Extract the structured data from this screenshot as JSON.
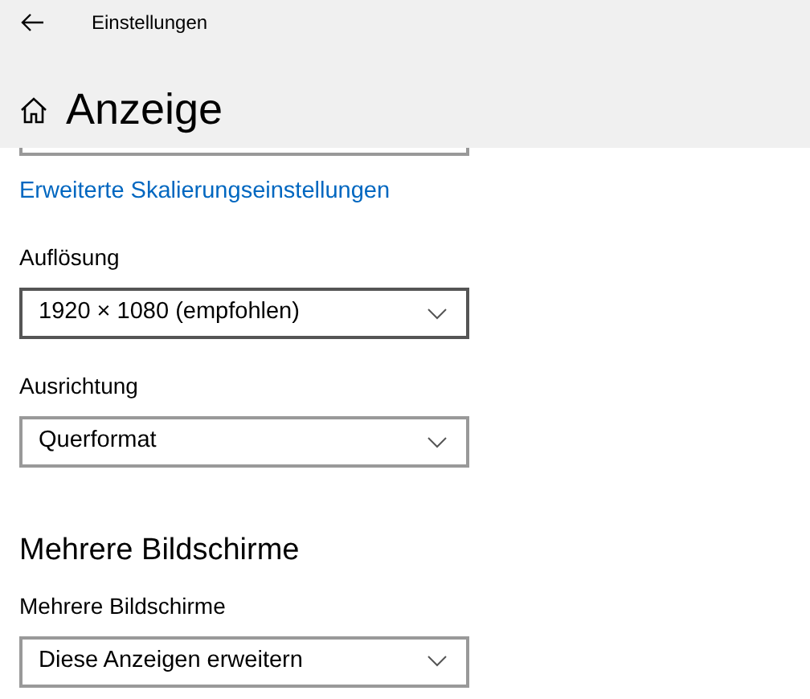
{
  "window": {
    "title": "Einstellungen"
  },
  "page": {
    "title": "Anzeige"
  },
  "scrolled_control": {
    "kind": "dropdown"
  },
  "link": "Erweiterte Skalierungseinstellungen",
  "sections": [
    {
      "kind": "fields",
      "fields": [
        {
          "label": "Auflösung",
          "value": "1920 × 1080 (empfohlen)",
          "hovered": true
        },
        {
          "label": "Ausrichtung",
          "value": "Querformat",
          "hovered": false
        }
      ]
    },
    {
      "kind": "heading",
      "title": "Mehrere Bildschirme",
      "fields": [
        {
          "label": "Mehrere Bildschirme",
          "value": "Diese Anzeigen erweitern",
          "hovered": false
        }
      ]
    }
  ]
}
